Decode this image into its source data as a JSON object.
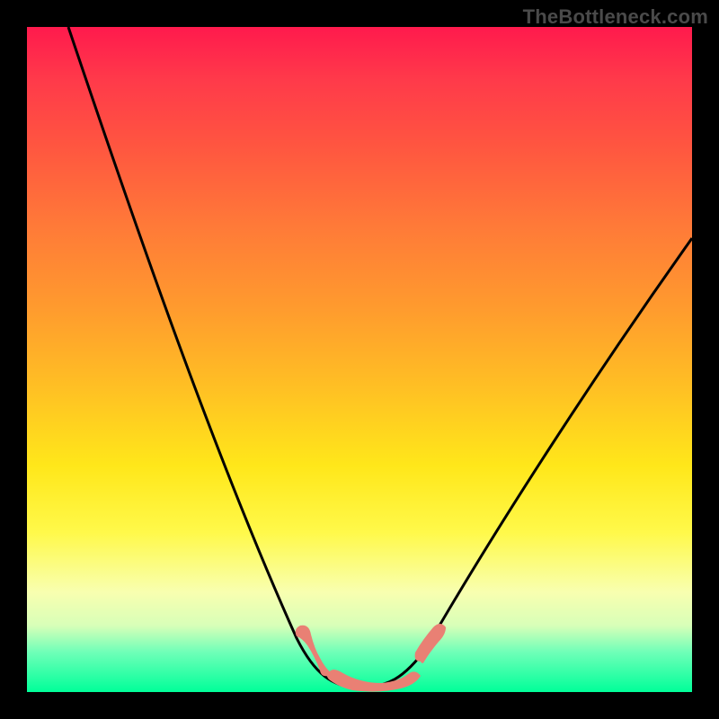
{
  "watermark": "TheBottleneck.com",
  "chart_data": {
    "type": "line",
    "title": "",
    "xlabel": "",
    "ylabel": "",
    "xlim": [
      0,
      100
    ],
    "ylim": [
      0,
      100
    ],
    "series": [
      {
        "name": "bottleneck-curve",
        "x": [
          6,
          10,
          14,
          18,
          22,
          26,
          30,
          34,
          38,
          41,
          44,
          47,
          50,
          53,
          56,
          60,
          64,
          68,
          72,
          76,
          80,
          84,
          88,
          92,
          96,
          100
        ],
        "y": [
          100,
          92,
          84,
          76,
          68,
          60,
          52,
          44,
          35,
          25,
          15,
          7,
          2,
          0,
          0,
          2,
          7,
          14,
          22,
          30,
          38,
          45,
          52,
          58,
          63,
          68
        ]
      }
    ],
    "annotations": [
      {
        "name": "flat-region-marker",
        "x_start": 42,
        "x_end": 58,
        "y": 1
      }
    ],
    "gradient_stops": [
      {
        "pos": 0,
        "color": "#ff1a4d"
      },
      {
        "pos": 50,
        "color": "#ffbf24"
      },
      {
        "pos": 80,
        "color": "#fff94a"
      },
      {
        "pos": 100,
        "color": "#00ff99"
      }
    ]
  }
}
